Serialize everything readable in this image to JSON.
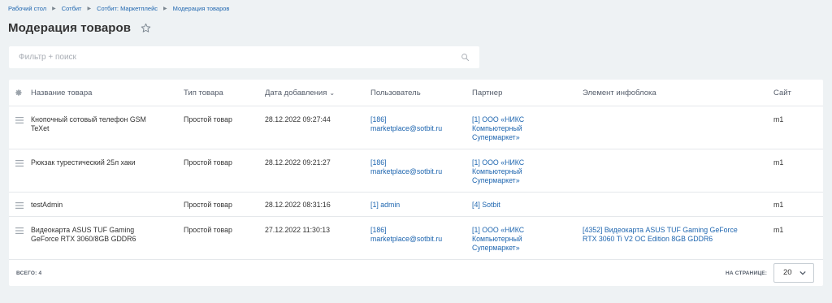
{
  "breadcrumb": [
    "Рабочий стол",
    "Сотбит",
    "Сотбит: Маркетплейс",
    "Модерация товаров"
  ],
  "page_title": "Модерация товаров",
  "filter": {
    "placeholder": "Фильтр + поиск"
  },
  "columns": [
    "Название товара",
    "Тип товара",
    "Дата добавления",
    "Пользователь",
    "Партнер",
    "Элемент инфоблока",
    "Сайт"
  ],
  "rows": [
    {
      "name": [
        "Кнопочный сотовый телефон GSM",
        "TeXet"
      ],
      "type": "Простой товар",
      "date": "28.12.2022 09:27:44",
      "user": [
        "[186]",
        "marketplace@sotbit.ru"
      ],
      "partner": [
        "[1] ООО «НИКС",
        "Компьютерный",
        "Супермаркет»"
      ],
      "element": [],
      "site": "m1"
    },
    {
      "name": [
        "Рюкзак турестический 25л хаки"
      ],
      "type": "Простой товар",
      "date": "28.12.2022 09:21:27",
      "user": [
        "[186]",
        "marketplace@sotbit.ru"
      ],
      "partner": [
        "[1] ООО «НИКС",
        "Компьютерный",
        "Супермаркет»"
      ],
      "element": [],
      "site": "m1"
    },
    {
      "name": [
        "testAdmin"
      ],
      "type": "Простой товар",
      "date": "28.12.2022 08:31:16",
      "user": [
        "[1] admin"
      ],
      "partner": [
        "[4] Sotbit"
      ],
      "element": [],
      "site": "m1"
    },
    {
      "name": [
        "Видеокарта ASUS TUF Gaming",
        "GeForce RTX 3060/8GB GDDR6"
      ],
      "type": "Простой товар",
      "date": "27.12.2022 11:30:13",
      "user": [
        "[186]",
        "marketplace@sotbit.ru"
      ],
      "partner": [
        "[1] ООО «НИКС",
        "Компьютерный",
        "Супермаркет»"
      ],
      "element": [
        "[4352] Видеокарта ASUS TUF Gaming GeForce",
        "RTX 3060 Ti V2 OC Edition 8GB GDDR6"
      ],
      "site": "m1"
    }
  ],
  "footer": {
    "total_label": "ВСЕГО:",
    "total_value": "4",
    "per_page_label": "НА СТРАНИЦЕ:",
    "per_page_value": "20"
  },
  "colors": {
    "link": "#2067b0",
    "background": "#eef2f4",
    "text": "#333333"
  },
  "icons": {
    "favorite": "star-icon",
    "search": "search-icon",
    "settings": "gear-icon",
    "row_menu": "drag-icon",
    "select": "chevron-down-icon"
  }
}
